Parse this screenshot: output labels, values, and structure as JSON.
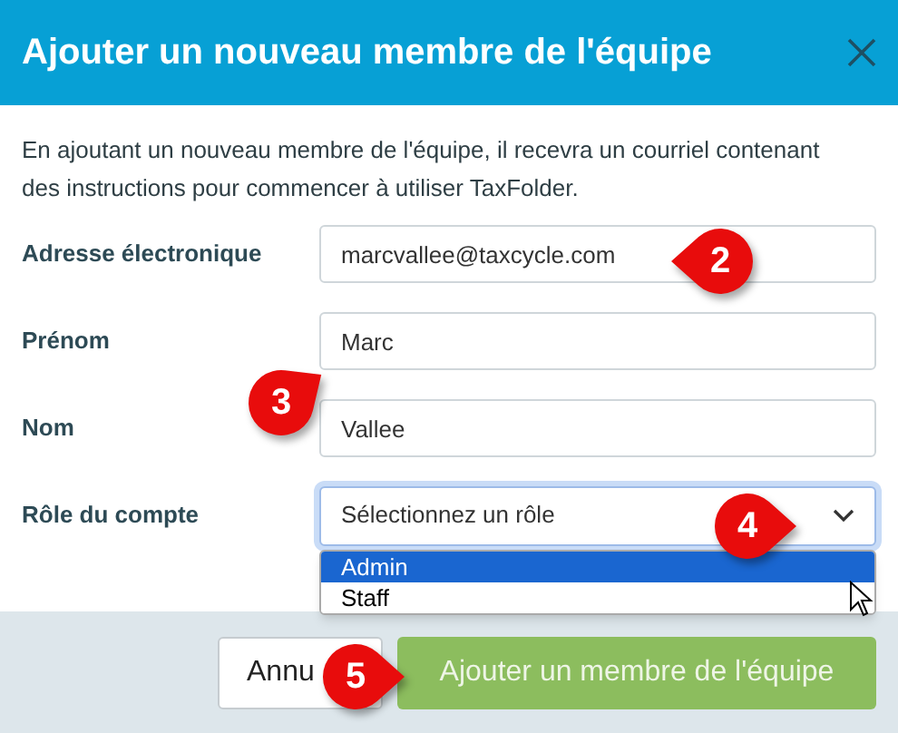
{
  "dialog": {
    "title": "Ajouter un nouveau membre de l'équipe",
    "description": "En ajoutant un nouveau membre de l'équipe, il recevra un courriel contenant des instructions pour commencer à utiliser TaxFolder.",
    "fields": [
      {
        "kind": "text",
        "label": "Adresse électronique",
        "value": "marcvallee@taxcycle.com"
      },
      {
        "kind": "text",
        "label": "Prénom",
        "value": "Marc"
      },
      {
        "kind": "text",
        "label": "Nom",
        "value": "Vallee"
      },
      {
        "kind": "select",
        "label": "Rôle du compte",
        "value": "Sélectionnez un rôle",
        "expanded": true,
        "options": [
          {
            "label": "Admin",
            "selected": true
          },
          {
            "label": "Staff",
            "selected": false
          }
        ]
      }
    ],
    "buttons": [
      {
        "kind": "secondary",
        "label": "Annu"
      },
      {
        "kind": "primary",
        "label": "Ajouter un membre de l'équipe"
      }
    ]
  },
  "callouts": [
    {
      "number": "2"
    },
    {
      "number": "3"
    },
    {
      "number": "4"
    },
    {
      "number": "5"
    }
  ]
}
